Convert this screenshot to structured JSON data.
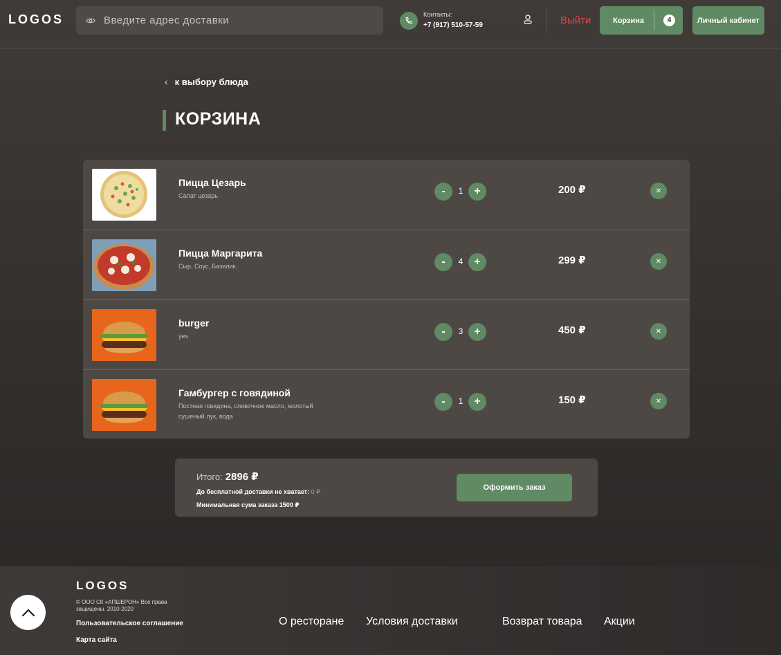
{
  "header": {
    "logo": "LOGOS",
    "address_placeholder": "Введите адрес доставки",
    "contacts_label": "Контакты:",
    "phone": "+7 (917) 510-57-59",
    "logout": "Выйти",
    "cart_label": "Корзина",
    "cart_count": "4",
    "account_label": "Личный кабинет"
  },
  "back_link": "к выбору блюда",
  "page_title": "КОРЗИНА",
  "cart": {
    "items": [
      {
        "name": "Пицца Цезарь",
        "desc": "Салат цезарь",
        "qty": "1",
        "price": "200 ₽",
        "minus": "-",
        "plus": "+",
        "image": "pizza-caesar"
      },
      {
        "name": "Пицца Маргарита",
        "desc": "Сыр, Соус, Базилик.",
        "qty": "4",
        "price": "299 ₽",
        "minus": "-",
        "plus": "+",
        "image": "pizza-margarita"
      },
      {
        "name": "burger",
        "desc": "yes",
        "qty": "3",
        "price": "450 ₽",
        "minus": "-",
        "plus": "+",
        "image": "burger"
      },
      {
        "name": "Гамбургер с говядиной",
        "desc": "Постная говядина, сливочное масло, молотый сушеный лук, вода",
        "qty": "1",
        "price": "150 ₽",
        "minus": "-",
        "plus": "+",
        "image": "burger"
      }
    ]
  },
  "summary": {
    "total_label": "Итого:",
    "total_value": "2896 ₽",
    "free_delivery_label": "До бесплатной доставки не хватает:",
    "free_delivery_value": "0 ₽",
    "min_order": "Минимальная сума заказа 1500 ₽",
    "order_button": "Оформить заказ"
  },
  "footer": {
    "logo": "LOGOS",
    "copyright": "© ООО СК «АПШЕРОН» Все права защищены. 2010-2020",
    "links": [
      "Пользовательское соглашение",
      "Карта сайта"
    ],
    "nav": [
      "О ресторане",
      "Условия доставки",
      "Возврат товара",
      "Акции"
    ]
  },
  "colors": {
    "accent": "#5f8a63",
    "logout": "#d9464f",
    "panel": "#4e4845"
  }
}
